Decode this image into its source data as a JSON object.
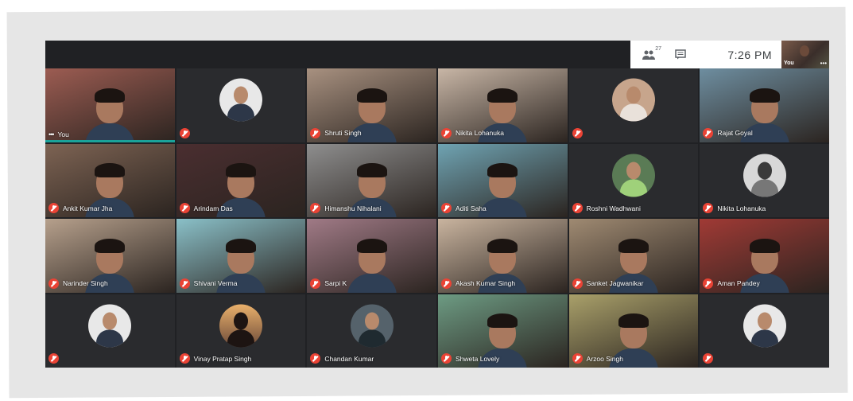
{
  "toolbar": {
    "participants_icon": "people-icon",
    "participants_count": "27",
    "chat_icon": "chat-icon",
    "time": "7:26 PM"
  },
  "self_view": {
    "label": "You",
    "more": "•••"
  },
  "participants": [
    {
      "name": "You",
      "kind": "video",
      "bg": "#9c5c52",
      "more": "•••",
      "muted": false,
      "speaking": true
    },
    {
      "name": "",
      "kind": "avatar",
      "style": "",
      "muted": true
    },
    {
      "name": "Shruti Singh",
      "kind": "video",
      "bg": "#a89180",
      "muted": true
    },
    {
      "name": "Nikita Lohanuka",
      "kind": "video",
      "bg": "#c8b6a6",
      "muted": true
    },
    {
      "name": "",
      "kind": "avatar",
      "style": "photo",
      "muted": true
    },
    {
      "name": "Rajat Goyal",
      "kind": "video",
      "bg": "#6e8ea0",
      "muted": true
    },
    {
      "name": "Ankit Kumar Jha",
      "kind": "video",
      "bg": "#7d6353",
      "muted": true
    },
    {
      "name": "Arindam Das",
      "kind": "video",
      "bg": "#4a2e30",
      "muted": true
    },
    {
      "name": "Himanshu Nihalani",
      "kind": "video",
      "bg": "#8e8e8e",
      "muted": true
    },
    {
      "name": "Aditi Saha",
      "kind": "video",
      "bg": "#6fa3b2",
      "muted": true
    },
    {
      "name": "Roshni Wadhwani",
      "kind": "avatar",
      "style": "grn",
      "muted": true
    },
    {
      "name": "Nikita Lohanuka",
      "kind": "avatar",
      "style": "bw",
      "muted": true
    },
    {
      "name": "Narinder Singh",
      "kind": "video",
      "bg": "#b6a08c",
      "muted": true
    },
    {
      "name": "Shivani Verma",
      "kind": "video",
      "bg": "#8ac0c8",
      "muted": true
    },
    {
      "name": "Sarpi K",
      "kind": "video",
      "bg": "#a07a86",
      "muted": true
    },
    {
      "name": "Akash Kumar Singh",
      "kind": "video",
      "bg": "#c9b49f",
      "muted": true
    },
    {
      "name": "Sanket Jagwanikar",
      "kind": "video",
      "bg": "#9f8a72",
      "muted": true
    },
    {
      "name": "Aman Pandey",
      "kind": "video",
      "bg": "#a03a35",
      "muted": true
    },
    {
      "name": "",
      "kind": "avatar",
      "style": "",
      "muted": true
    },
    {
      "name": "Vinay Pratap Singh",
      "kind": "avatar",
      "style": "sunset",
      "muted": true
    },
    {
      "name": "Chandan Kumar",
      "kind": "avatar",
      "style": "dim",
      "muted": true
    },
    {
      "name": "Shweta Lovely",
      "kind": "video",
      "bg": "#6d9b83",
      "muted": true
    },
    {
      "name": "Arzoo Singh",
      "kind": "video",
      "bg": "#a9a06a",
      "muted": true
    },
    {
      "name": "",
      "kind": "avatar",
      "style": "",
      "muted": true
    }
  ]
}
